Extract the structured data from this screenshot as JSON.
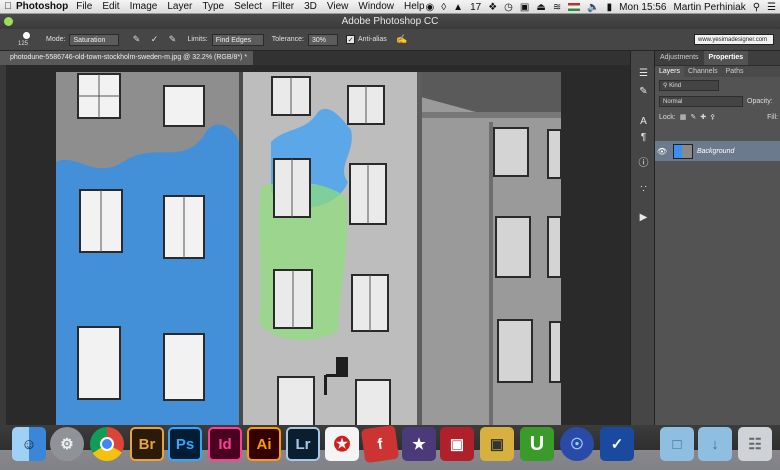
{
  "menubar": {
    "apple": "",
    "app": "Photoshop",
    "items": [
      "File",
      "Edit",
      "Image",
      "Layer",
      "Type",
      "Select",
      "Filter",
      "3D",
      "View",
      "Window",
      "Help"
    ],
    "status_number": "17",
    "clock": "Mon 15:56",
    "user": "Martin Perhiniak"
  },
  "window": {
    "title": "Adobe Photoshop CC"
  },
  "options": {
    "brush_size": "125",
    "mode_label": "Mode:",
    "mode_value": "Saturation",
    "limits_label": "Limits:",
    "limits_value": "Find Edges",
    "tolerance_label": "Tolerance:",
    "tolerance_value": "30%",
    "antialias_label": "Anti-alias",
    "website": "www.yesimadesigner.com"
  },
  "document": {
    "tab_label": "photodune-5586746-old-town-stockholm-sweden-m.jpg @ 32.2% (RGB/8*) *"
  },
  "panel": {
    "top_tabs": [
      "Adjustments",
      "Properties"
    ],
    "layer_tabs": [
      "Layers",
      "Channels",
      "Paths"
    ],
    "kind_label": "Kind",
    "blend_mode": "Normal",
    "opacity_label": "Opacity:",
    "lock_label": "Lock:",
    "fill_label": "Fill:",
    "layer_name": "Background"
  },
  "dock": {
    "apps": [
      {
        "label": "",
        "icon": "finder-icon"
      },
      {
        "label": "",
        "icon": "system-preferences-icon"
      },
      {
        "label": "",
        "icon": "chrome-icon"
      },
      {
        "label": "Br",
        "icon": "bridge-icon",
        "color": "#e8a33a"
      },
      {
        "label": "Ps",
        "icon": "photoshop-icon",
        "color": "#31a8ff"
      },
      {
        "label": "Id",
        "icon": "indesign-icon",
        "color": "#ff3f94"
      },
      {
        "label": "Ai",
        "icon": "illustrator-icon",
        "color": "#ff9a00"
      },
      {
        "label": "Lr",
        "icon": "lightroom-icon",
        "color": "#a8c8e8"
      },
      {
        "label": "",
        "icon": "acrobat-icon"
      },
      {
        "label": "",
        "icon": "flash-icon"
      },
      {
        "label": "",
        "icon": "imovie-icon"
      },
      {
        "label": "",
        "icon": "photo-booth-icon"
      },
      {
        "label": "",
        "icon": "delivery-truck-icon"
      },
      {
        "label": "",
        "icon": "uploader-icon"
      },
      {
        "label": "",
        "icon": "network-icon"
      },
      {
        "label": "",
        "icon": "checkmark-app-icon"
      },
      {
        "label": "",
        "icon": "folder-icon"
      },
      {
        "label": "",
        "icon": "downloads-folder-icon"
      },
      {
        "label": "",
        "icon": "trash-icon"
      }
    ]
  }
}
